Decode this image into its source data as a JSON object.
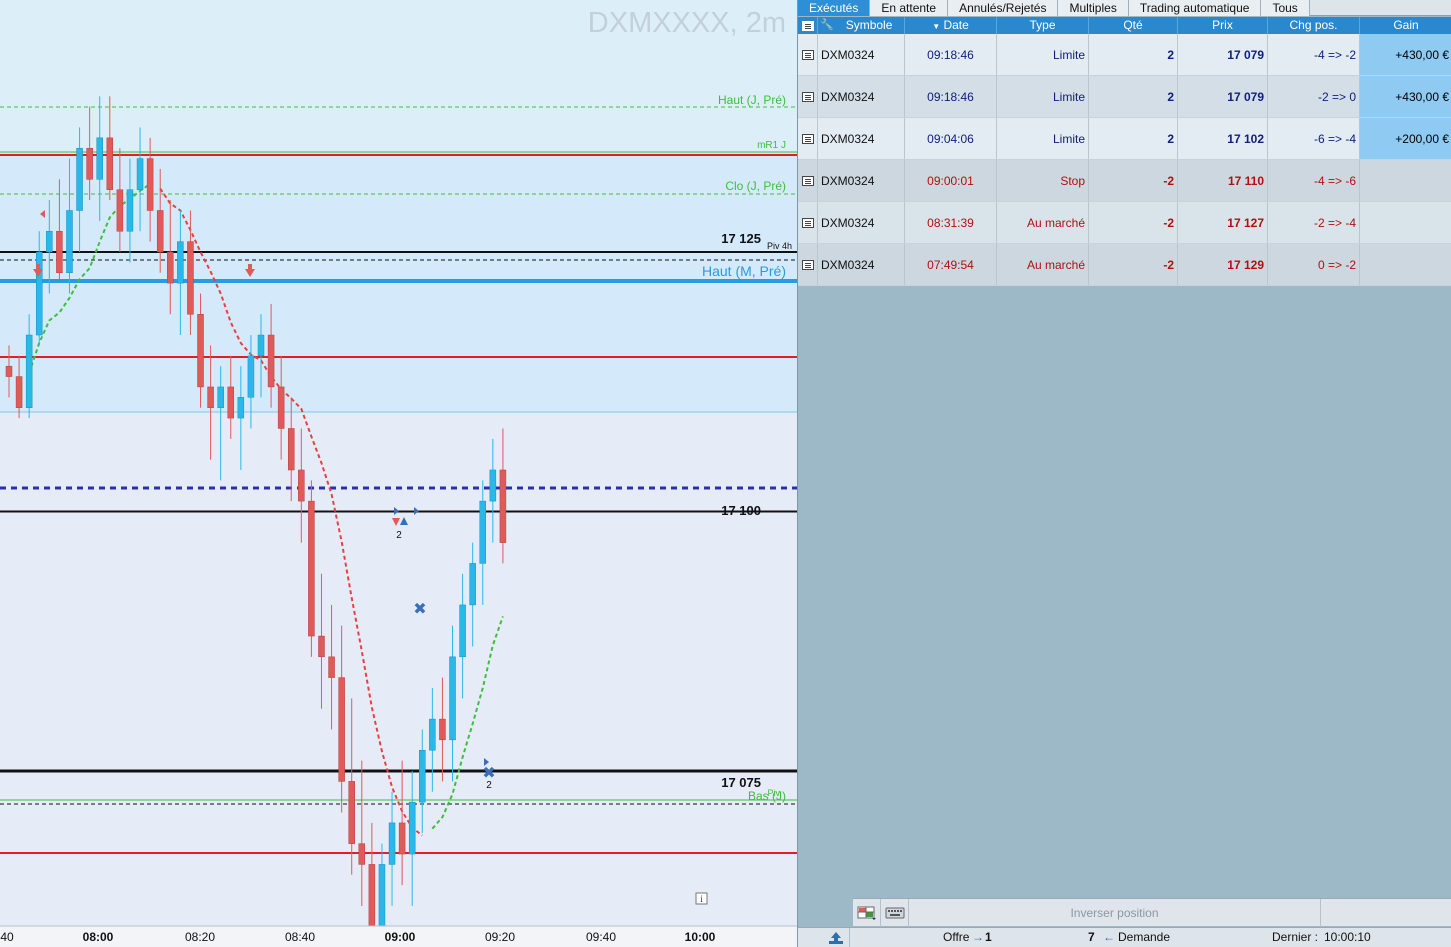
{
  "chart": {
    "title": "DXMXXXX, 2m",
    "level_labels": {
      "haut_j_pre": "Haut (J, Pré)",
      "mr1_j": "mR1 J",
      "clo_j_pre": "Clo (J, Pré)",
      "piv_4h": "Piv 4h",
      "haut_m_pre": "Haut (M, Pré)",
      "bas_j": "Bas (J)",
      "piv": "Piv"
    },
    "price_labels": {
      "p17125": "17 125",
      "p17100": "17 100",
      "p17075": "17 075"
    },
    "trade_marker_counts": {
      "first": "2",
      "second": "2"
    },
    "time_labels": [
      "40",
      "08:00",
      "08:20",
      "08:40",
      "09:00",
      "09:20",
      "09:40",
      "10:00"
    ],
    "info_icon": "info-icon",
    "colors": {
      "bull": "#29b8e8",
      "bear": "#e05a5a",
      "resistance": "#e02020",
      "blue_level": "#2a9be0",
      "green_level": "#3cbf3c"
    }
  },
  "chart_data": {
    "type": "candlestick",
    "instrument": "DXMXXXX",
    "timeframe": "2m",
    "ylevels": {
      "upper": 17125,
      "middle": 17100,
      "lower": 17075
    },
    "ohlc": [
      [
        17114,
        17116,
        17111,
        17113
      ],
      [
        17113,
        17115,
        17109,
        17110
      ],
      [
        17110,
        17119,
        17109,
        17117
      ],
      [
        17117,
        17127,
        17116,
        17125
      ],
      [
        17125,
        17130,
        17121,
        17127
      ],
      [
        17127,
        17132,
        17122,
        17123
      ],
      [
        17123,
        17134,
        17121,
        17129
      ],
      [
        17129,
        17137,
        17125,
        17135
      ],
      [
        17135,
        17139,
        17130,
        17132
      ],
      [
        17132,
        17140,
        17128,
        17136
      ],
      [
        17136,
        17140,
        17130,
        17131
      ],
      [
        17131,
        17135,
        17125,
        17127
      ],
      [
        17127,
        17134,
        17124,
        17131
      ],
      [
        17131,
        17137,
        17127,
        17134
      ],
      [
        17134,
        17136,
        17126,
        17129
      ],
      [
        17129,
        17133,
        17123,
        17125
      ],
      [
        17125,
        17130,
        17119,
        17122
      ],
      [
        17122,
        17129,
        17117,
        17126
      ],
      [
        17126,
        17129,
        17117,
        17119
      ],
      [
        17119,
        17121,
        17110,
        17112
      ],
      [
        17112,
        17116,
        17105,
        17110
      ],
      [
        17110,
        17114,
        17103,
        17112
      ],
      [
        17112,
        17115,
        17107,
        17109
      ],
      [
        17109,
        17114,
        17104,
        17111
      ],
      [
        17111,
        17117,
        17108,
        17115
      ],
      [
        17115,
        17119,
        17111,
        17117
      ],
      [
        17117,
        17120,
        17110,
        17112
      ],
      [
        17112,
        17115,
        17105,
        17108
      ],
      [
        17108,
        17111,
        17101,
        17104
      ],
      [
        17104,
        17108,
        17097,
        17101
      ],
      [
        17101,
        17103,
        17086,
        17088
      ],
      [
        17088,
        17094,
        17081,
        17086
      ],
      [
        17086,
        17091,
        17079,
        17084
      ],
      [
        17084,
        17089,
        17071,
        17074
      ],
      [
        17074,
        17082,
        17065,
        17068
      ],
      [
        17068,
        17076,
        17062,
        17066
      ],
      [
        17066,
        17070,
        17056,
        17059
      ],
      [
        17059,
        17068,
        17054,
        17066
      ],
      [
        17066,
        17073,
        17062,
        17070
      ],
      [
        17070,
        17076,
        17064,
        17067
      ],
      [
        17067,
        17075,
        17062,
        17072
      ],
      [
        17072,
        17079,
        17069,
        17077
      ],
      [
        17077,
        17083,
        17073,
        17080
      ],
      [
        17080,
        17084,
        17074,
        17078
      ],
      [
        17078,
        17089,
        17074,
        17086
      ],
      [
        17086,
        17094,
        17082,
        17091
      ],
      [
        17091,
        17097,
        17087,
        17095
      ],
      [
        17095,
        17103,
        17091,
        17101
      ],
      [
        17101,
        17107,
        17097,
        17104
      ],
      [
        17104,
        17108,
        17095,
        17097
      ]
    ],
    "xlabels": [
      "40",
      "08:00",
      "08:20",
      "08:40",
      "09:00",
      "09:20",
      "09:40",
      "10:00"
    ]
  },
  "orders": {
    "tabs": [
      "Exécutés",
      "En attente",
      "Annulés/Rejetés",
      "Multiples",
      "Trading automatique",
      "Tous"
    ],
    "active_tab": "Exécutés",
    "columns": [
      "Symbole",
      "Date",
      "Type",
      "Qté",
      "Prix",
      "Chg pos.",
      "Gain"
    ],
    "rows": [
      {
        "symbol": "DXM0324",
        "date": "09:18:46",
        "type": "Limite",
        "qty": "2",
        "price": "17 079",
        "chg": "-4 => -2",
        "gain": "+430,00 €",
        "side": "buy"
      },
      {
        "symbol": "DXM0324",
        "date": "09:18:46",
        "type": "Limite",
        "qty": "2",
        "price": "17 079",
        "chg": "-2 => 0",
        "gain": "+430,00 €",
        "side": "buy"
      },
      {
        "symbol": "DXM0324",
        "date": "09:04:06",
        "type": "Limite",
        "qty": "2",
        "price": "17 102",
        "chg": "-6 => -4",
        "gain": "+200,00 €",
        "side": "buy"
      },
      {
        "symbol": "DXM0324",
        "date": "09:00:01",
        "type": "Stop",
        "qty": "-2",
        "price": "17 110",
        "chg": "-4 => -6",
        "gain": "",
        "side": "sell"
      },
      {
        "symbol": "DXM0324",
        "date": "08:31:39",
        "type": "Au marché",
        "qty": "-2",
        "price": "17 127",
        "chg": "-2 => -4",
        "gain": "",
        "side": "sell"
      },
      {
        "symbol": "DXM0324",
        "date": "07:49:54",
        "type": "Au marché",
        "qty": "-2",
        "price": "17 129",
        "chg": "0 => -2",
        "gain": "",
        "side": "sell"
      }
    ],
    "reverse_position": "Inverser position",
    "status": {
      "offer_label": "Offre",
      "offer_value": "1",
      "bid_value": "7",
      "bid_label": "Demande",
      "last_label": "Dernier :",
      "last_time": "10:00:10"
    },
    "icons": [
      "document-icon",
      "wrench-icon",
      "grid-icon",
      "keyboard-icon",
      "upload-icon",
      "arrow-right-icon",
      "arrow-left-icon"
    ]
  }
}
